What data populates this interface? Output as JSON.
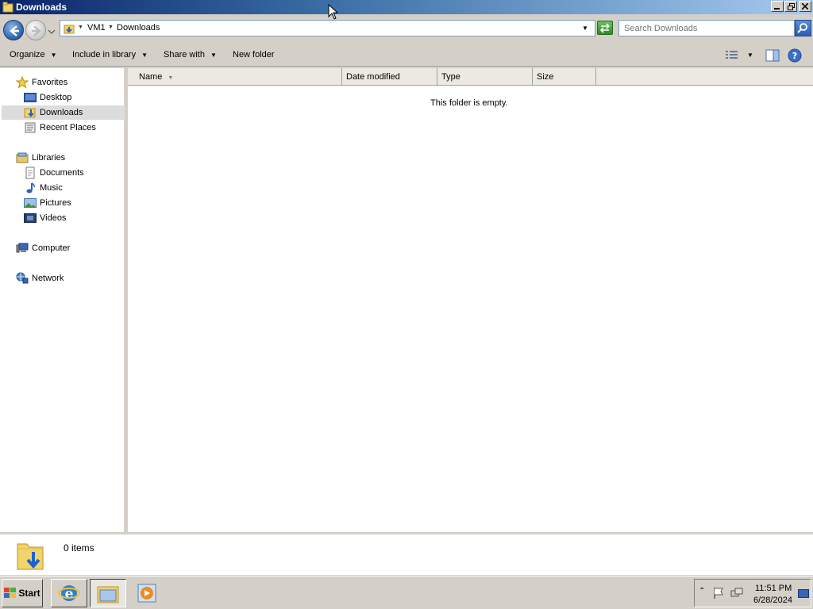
{
  "window": {
    "title": "Downloads"
  },
  "address": {
    "crumbs": [
      "VM1",
      "Downloads"
    ],
    "search_placeholder": "Search Downloads"
  },
  "toolbar": {
    "organize": "Organize",
    "include_in_library": "Include in library",
    "share_with": "Share with",
    "new_folder": "New folder"
  },
  "navigation": {
    "favorites": "Favorites",
    "desktop": "Desktop",
    "downloads": "Downloads",
    "recent_places": "Recent Places",
    "libraries": "Libraries",
    "documents": "Documents",
    "music": "Music",
    "pictures": "Pictures",
    "videos": "Videos",
    "computer": "Computer",
    "network": "Network"
  },
  "columns": {
    "name": "Name",
    "date_modified": "Date modified",
    "type": "Type",
    "size": "Size"
  },
  "content": {
    "empty_message": "This folder is empty."
  },
  "details": {
    "item_count": "0 items"
  },
  "taskbar": {
    "start": "Start",
    "time": "11:51 PM",
    "date": "6/28/2024"
  }
}
